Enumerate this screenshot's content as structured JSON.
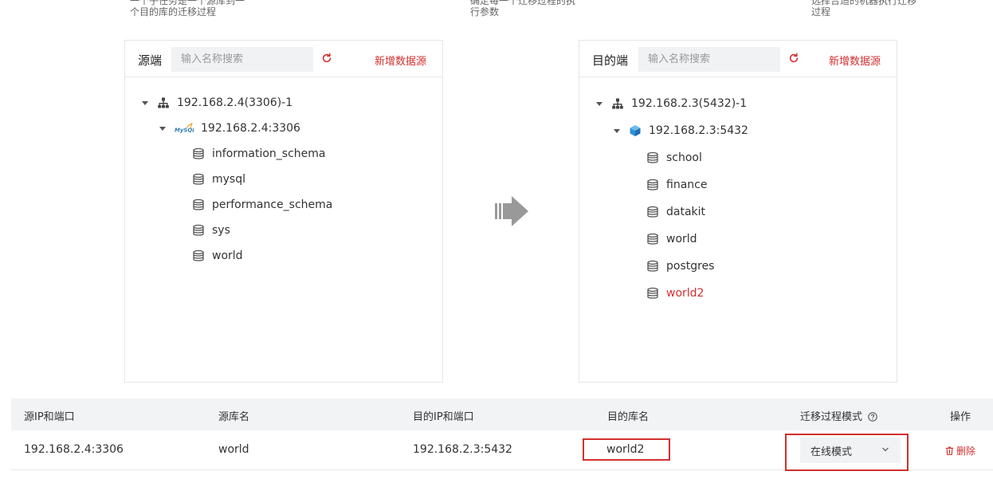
{
  "top_hints": {
    "left": [
      "一个子任务是一个源库到一",
      "个目的库的迁移过程"
    ],
    "middle": [
      "确定每一个迁移过程的执",
      "行参数"
    ],
    "right": [
      "选择合适的机器执行迁移",
      "过程"
    ]
  },
  "source": {
    "title": "源端",
    "search_placeholder": "输入名称搜索",
    "add_label": "新增数据源",
    "root": "192.168.2.4(3306)-1",
    "instance": "192.168.2.4:3306",
    "instance_logo": "MySQL",
    "databases": [
      "information_schema",
      "mysql",
      "performance_schema",
      "sys",
      "world"
    ]
  },
  "target": {
    "title": "目的端",
    "search_placeholder": "输入名称搜索",
    "add_label": "新增数据源",
    "root": "192.168.2.3(5432)-1",
    "instance": "192.168.2.3:5432",
    "databases": [
      "school",
      "finance",
      "datakit",
      "world",
      "postgres",
      "world2"
    ],
    "selected": "world2"
  },
  "table": {
    "headers": {
      "src_ip": "源IP和端口",
      "src_db": "源库名",
      "dst_ip": "目的IP和端口",
      "dst_db": "目的库名",
      "mode": "迁移过程模式",
      "ops": "操作"
    },
    "row": {
      "src_ip": "192.168.2.4:3306",
      "src_db": "world",
      "dst_ip": "192.168.2.3:5432",
      "dst_db": "world2",
      "mode": "在线模式",
      "delete_label": "删除"
    }
  },
  "colors": {
    "accent": "#d32f2f",
    "postgres_blue": "#2f8fd8"
  },
  "icons": [
    "refresh-icon",
    "caret-down-icon",
    "network-tree-icon",
    "mysql-logo-icon",
    "postgres-cube-icon",
    "database-icon",
    "transfer-arrow-icon",
    "help-circle-icon",
    "chevron-down-icon",
    "trash-icon"
  ]
}
